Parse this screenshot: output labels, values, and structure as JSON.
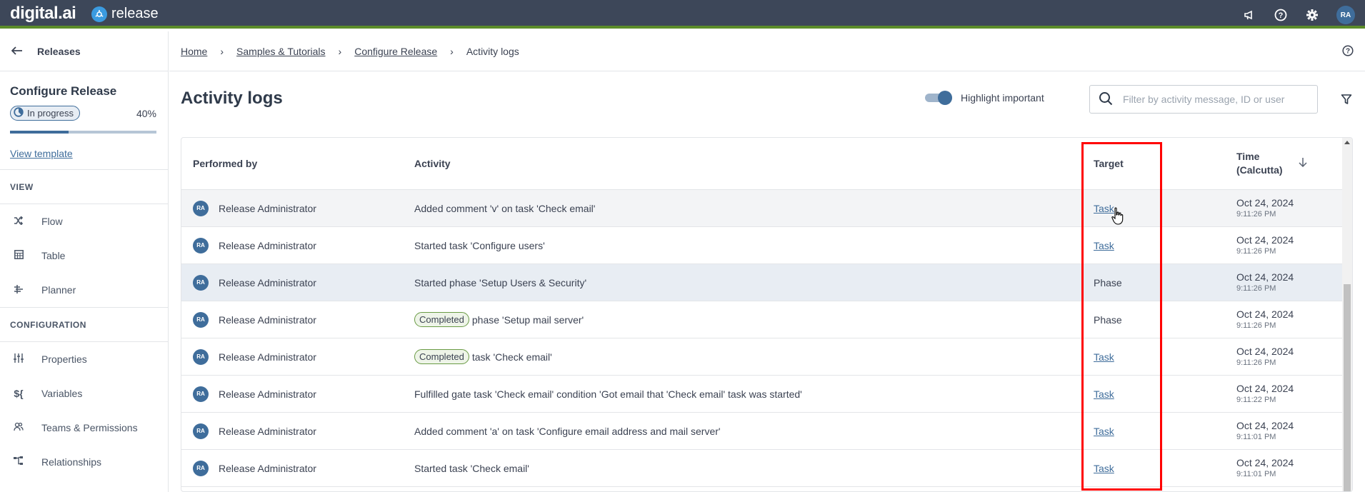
{
  "topbar": {
    "brand": "digital.ai",
    "product": "release",
    "icons": [
      "megaphone-icon",
      "help-icon",
      "gear-icon"
    ],
    "user_initials": "RA"
  },
  "sidebar": {
    "back_label": "Releases",
    "release_title": "Configure Release",
    "status": "In progress",
    "progress_label": "40%",
    "progress_fraction": 0.4,
    "view_template": "View template",
    "view_section": "VIEW",
    "view_items": [
      {
        "label": "Flow",
        "icon": "shuffle-icon"
      },
      {
        "label": "Table",
        "icon": "table-icon"
      },
      {
        "label": "Planner",
        "icon": "planner-icon"
      }
    ],
    "config_section": "CONFIGURATION",
    "config_items": [
      {
        "label": "Properties",
        "icon": "sliders-icon"
      },
      {
        "label": "Variables",
        "icon": "variables-icon"
      },
      {
        "label": "Teams & Permissions",
        "icon": "team-icon"
      },
      {
        "label": "Relationships",
        "icon": "relationships-icon"
      }
    ]
  },
  "breadcrumb": {
    "items": [
      "Home",
      "Samples & Tutorials",
      "Configure Release"
    ],
    "current": "Activity logs"
  },
  "page": {
    "title": "Activity logs",
    "highlight_label": "Highlight important",
    "highlight_on": true,
    "search_placeholder": "Filter by activity message, ID or user",
    "search_value": ""
  },
  "table": {
    "columns": {
      "performed_by": "Performed by",
      "activity": "Activity",
      "target": "Target",
      "time_line1": "Time",
      "time_line2": "(Calcutta)"
    },
    "rows": [
      {
        "initials": "RA",
        "user": "Release Administrator",
        "badge": "",
        "activity": "Added comment 'v' on task 'Check email'",
        "target": "Task",
        "target_link": true,
        "date": "Oct 24, 2024",
        "time": "9:11:26 PM",
        "state": "hover"
      },
      {
        "initials": "RA",
        "user": "Release Administrator",
        "badge": "",
        "activity": "Started task 'Configure users'",
        "target": "Task",
        "target_link": true,
        "date": "Oct 24, 2024",
        "time": "9:11:26 PM",
        "state": ""
      },
      {
        "initials": "RA",
        "user": "Release Administrator",
        "badge": "",
        "activity": "Started phase 'Setup Users & Security'",
        "target": "Phase",
        "target_link": false,
        "date": "Oct 24, 2024",
        "time": "9:11:26 PM",
        "state": "important"
      },
      {
        "initials": "RA",
        "user": "Release Administrator",
        "badge": "Completed",
        "activity": "phase 'Setup mail server'",
        "target": "Phase",
        "target_link": false,
        "date": "Oct 24, 2024",
        "time": "9:11:26 PM",
        "state": ""
      },
      {
        "initials": "RA",
        "user": "Release Administrator",
        "badge": "Completed",
        "activity": "task 'Check email'",
        "target": "Task",
        "target_link": true,
        "date": "Oct 24, 2024",
        "time": "9:11:26 PM",
        "state": ""
      },
      {
        "initials": "RA",
        "user": "Release Administrator",
        "badge": "",
        "activity": "Fulfilled gate task 'Check email' condition 'Got email that 'Check email' task was started'",
        "target": "Task",
        "target_link": true,
        "date": "Oct 24, 2024",
        "time": "9:11:22 PM",
        "state": ""
      },
      {
        "initials": "RA",
        "user": "Release Administrator",
        "badge": "",
        "activity": "Added comment 'a' on task 'Configure email address and mail server'",
        "target": "Task",
        "target_link": true,
        "date": "Oct 24, 2024",
        "time": "9:11:01 PM",
        "state": ""
      },
      {
        "initials": "RA",
        "user": "Release Administrator",
        "badge": "",
        "activity": "Started task 'Check email'",
        "target": "Task",
        "target_link": true,
        "date": "Oct 24, 2024",
        "time": "9:11:01 PM",
        "state": ""
      }
    ]
  },
  "colors": {
    "topbar": "#3d4759",
    "accent_green": "#5b8c2a",
    "primary": "#3f6d9b",
    "highlight_box": "#ff0000"
  }
}
